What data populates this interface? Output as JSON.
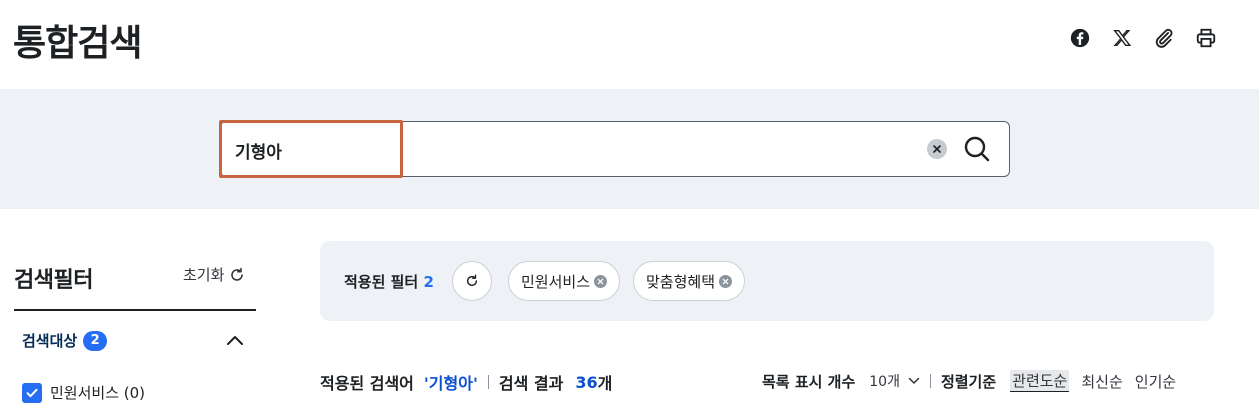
{
  "page": {
    "title": "통합검색"
  },
  "share": {
    "icons": [
      "facebook-icon",
      "x-icon",
      "link-icon",
      "print-icon"
    ]
  },
  "search": {
    "value": "기형아",
    "placeholder": ""
  },
  "filter": {
    "title": "검색필터",
    "reset_label": "초기화",
    "group": {
      "label": "검색대상",
      "count": "2"
    },
    "options": [
      {
        "label": "민원서비스 (0)",
        "checked": true
      }
    ]
  },
  "applied": {
    "label": "적용된 필터",
    "count": "2",
    "chips": [
      "민원서비스",
      "맞춤형혜택"
    ]
  },
  "results": {
    "keyword_label": "적용된 검색어",
    "keyword": "'기형아'",
    "count_label": "검색 결과",
    "count": "36",
    "count_unit": "개"
  },
  "list_controls": {
    "page_size_label": "목록 표시 개수",
    "page_size_value": "10개",
    "sort_label": "정렬기준",
    "sort_options": [
      "관련도순",
      "최신순",
      "인기순"
    ],
    "active_sort": "관련도순"
  },
  "colors": {
    "accent": "#256ef4",
    "highlight": "#c8643f",
    "band": "#eef1f5"
  }
}
